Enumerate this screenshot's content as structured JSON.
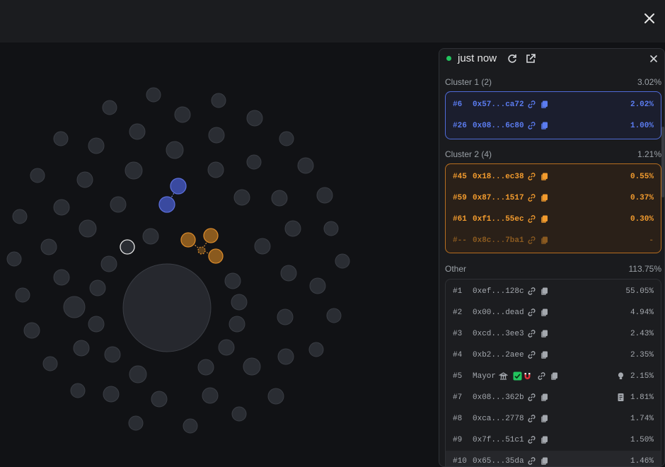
{
  "panel": {
    "updated": "just now",
    "clusters": [
      {
        "label": "Cluster 1 (2)",
        "percent": "3.02%",
        "color": "#4f6bd8",
        "rows": [
          {
            "rank": "#6",
            "addr": "0x57...ca72",
            "percent": "2.02%"
          },
          {
            "rank": "#26",
            "addr": "0x08...6c80",
            "percent": "1.00%"
          }
        ]
      },
      {
        "label": "Cluster 2 (4)",
        "percent": "1.21%",
        "color": "#e08a27",
        "rows": [
          {
            "rank": "#45",
            "addr": "0x18...ec38",
            "percent": "0.55%"
          },
          {
            "rank": "#59",
            "addr": "0x87...1517",
            "percent": "0.37%"
          },
          {
            "rank": "#61",
            "addr": "0xf1...55ec",
            "percent": "0.30%"
          },
          {
            "rank": "#--",
            "addr": "0x8c...7ba1",
            "percent": "-"
          }
        ]
      }
    ],
    "other": {
      "label": "Other",
      "percent": "113.75%",
      "rows": [
        {
          "rank": "#1",
          "addr": "0xef...128c",
          "percent": "55.05%"
        },
        {
          "rank": "#2",
          "addr": "0x00...dead",
          "percent": "4.94%"
        },
        {
          "rank": "#3",
          "addr": "0xcd...3ee3",
          "percent": "2.43%"
        },
        {
          "rank": "#4",
          "addr": "0xb2...2aee",
          "percent": "2.35%"
        },
        {
          "rank": "#5",
          "addr": "Mayor",
          "percent": "2.15%",
          "tag": "bulb-icon"
        },
        {
          "rank": "#7",
          "addr": "0x08...362b",
          "percent": "1.81%",
          "tag": "contract-icon"
        },
        {
          "rank": "#8",
          "addr": "0xca...2778",
          "percent": "1.74%"
        },
        {
          "rank": "#9",
          "addr": "0x7f...51c1",
          "percent": "1.50%"
        },
        {
          "rank": "#10",
          "addr": "0x65...35da",
          "percent": "1.46%"
        }
      ]
    }
  }
}
